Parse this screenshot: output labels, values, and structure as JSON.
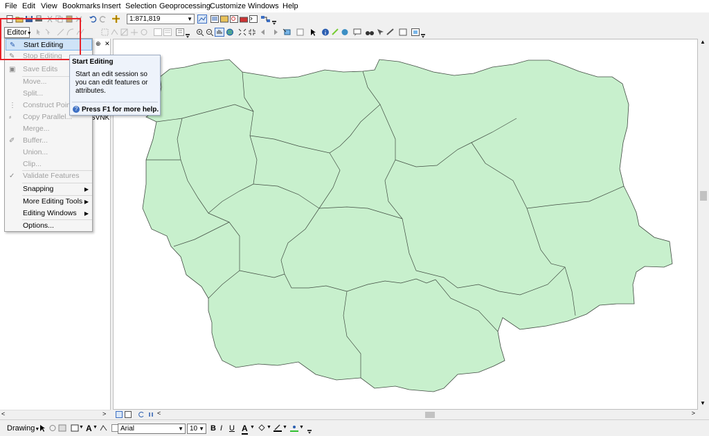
{
  "menubar": {
    "items": [
      "File",
      "Edit",
      "View",
      "Bookmarks",
      "Insert",
      "Selection",
      "Geoprocessing",
      "Customize",
      "Windows",
      "Help"
    ]
  },
  "toolbar": {
    "scale_value": "1:871,819",
    "editor_label": "Editor"
  },
  "editor_menu": {
    "items": [
      {
        "label": "Start Editing",
        "state": "highlighted",
        "icon": "pencil-icon"
      },
      {
        "label": "Stop Editing",
        "state": "disabled",
        "icon": "stop-pencil-icon"
      },
      {
        "label": "Save Edits",
        "state": "disabled",
        "icon": "save-icon"
      },
      {
        "label": "Move...",
        "state": "disabled"
      },
      {
        "label": "Split...",
        "state": "disabled"
      },
      {
        "label": "Construct Points...",
        "state": "disabled",
        "icon": "construct-points-icon"
      },
      {
        "label": "Copy Parallel...",
        "state": "disabled",
        "icon": "copy-parallel-icon"
      },
      {
        "label": "Merge...",
        "state": "disabled"
      },
      {
        "label": "Buffer...",
        "state": "disabled",
        "icon": "buffer-icon"
      },
      {
        "label": "Union...",
        "state": "disabled"
      },
      {
        "label": "Clip...",
        "state": "disabled"
      },
      {
        "label": "Validate Features",
        "state": "disabled",
        "icon": "validate-icon"
      },
      {
        "label": "Snapping",
        "state": "enabled",
        "submenu": true
      },
      {
        "label": "More Editing Tools",
        "state": "enabled",
        "submenu": true
      },
      {
        "label": "Editing Windows",
        "state": "enabled",
        "submenu": true
      },
      {
        "label": "Options...",
        "state": "enabled"
      }
    ]
  },
  "tooltip": {
    "title": "Start Editing",
    "body": "Start an edit session so you can edit features or attributes.",
    "help": "Press F1 for more help."
  },
  "toc": {
    "layer_fragment": "SVNK"
  },
  "drawing_toolbar": {
    "drawing_label": "Drawing",
    "font_name": "Arial",
    "font_size": "10",
    "bold": "B",
    "italic": "I",
    "underline": "U",
    "font_color_letter": "A"
  },
  "colors": {
    "map_fill": "#c8f0cd",
    "map_stroke": "#3f4a40",
    "highlight": "#cfe3f7",
    "annotation_red": "#e8232a"
  }
}
